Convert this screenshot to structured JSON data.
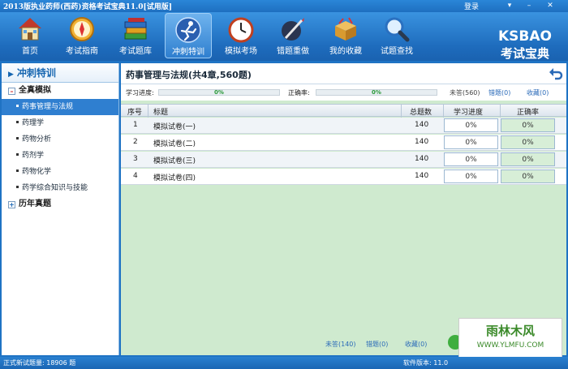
{
  "window": {
    "title": "2013版执业药师(西药)资格考试宝典11.0[试用版]",
    "login_label": "登录",
    "controls": [
      "minimize-icon",
      "restore-icon",
      "close-icon"
    ]
  },
  "toolbar": {
    "items": [
      {
        "label": "首页",
        "icon": "house-icon"
      },
      {
        "label": "考试指南",
        "icon": "compass-icon"
      },
      {
        "label": "考试题库",
        "icon": "books-icon"
      },
      {
        "label": "冲刺特训",
        "icon": "runner-icon"
      },
      {
        "label": "模拟考场",
        "icon": "clock-icon"
      },
      {
        "label": "错题重做",
        "icon": "pen-icon"
      },
      {
        "label": "我的收藏",
        "icon": "box-icon"
      },
      {
        "label": "试题查找",
        "icon": "magnifier-icon"
      }
    ],
    "active_index": 3
  },
  "logo": {
    "line1": "KSBAO",
    "line2": "考试宝典"
  },
  "sidebar": {
    "header": "冲刺特训",
    "group1": "全真模拟",
    "items": [
      {
        "label": "药事管理与法规"
      },
      {
        "label": "药理学"
      },
      {
        "label": "药物分析"
      },
      {
        "label": "药剂学"
      },
      {
        "label": "药物化学"
      },
      {
        "label": "药学综合知识与技能"
      }
    ],
    "active_item": 0,
    "group2": "历年真题"
  },
  "main": {
    "title": "药事管理与法规(共4章,560题)",
    "progress_label": "学习进度:",
    "progress_value": "0%",
    "accuracy_label": "正确率:",
    "accuracy_value": "0%",
    "unanswered": "未答(560)",
    "wrong": "错题(0)",
    "favorites": "收藏(0)"
  },
  "table": {
    "headers": [
      "序号",
      "标题",
      "总题数",
      "学习进度",
      "正确率"
    ],
    "rows": [
      {
        "no": "1",
        "title": "模拟试卷(一)",
        "total": "140",
        "progress": "0%",
        "accuracy": "0%"
      },
      {
        "no": "2",
        "title": "模拟试卷(二)",
        "total": "140",
        "progress": "0%",
        "accuracy": "0%"
      },
      {
        "no": "3",
        "title": "模拟试卷(三)",
        "total": "140",
        "progress": "0%",
        "accuracy": "0%"
      },
      {
        "no": "4",
        "title": "模拟试卷(四)",
        "total": "140",
        "progress": "0%",
        "accuracy": "0%"
      }
    ]
  },
  "bottom": {
    "unanswered": "未答(140)",
    "wrong": "错题(0)",
    "favorites": "收藏(0)"
  },
  "watermark": {
    "line1": "雨林木风",
    "line2": "WWW.YLMFU.COM"
  },
  "status": {
    "left": "正式新试题量: 18906 题",
    "right": "软件版本: 11.0"
  },
  "colors": {
    "accent": "#1f73c4",
    "table_green": "#cfeacf",
    "link": "#2a6ab8"
  }
}
